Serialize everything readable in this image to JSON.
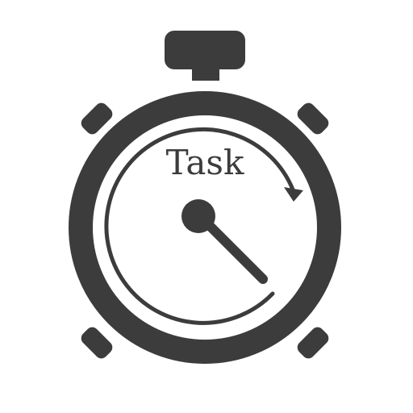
{
  "icon": {
    "name": "stopwatch-icon",
    "label": "Task",
    "colors": {
      "ink": "#3c3c3c",
      "background": "#ffffff"
    }
  }
}
